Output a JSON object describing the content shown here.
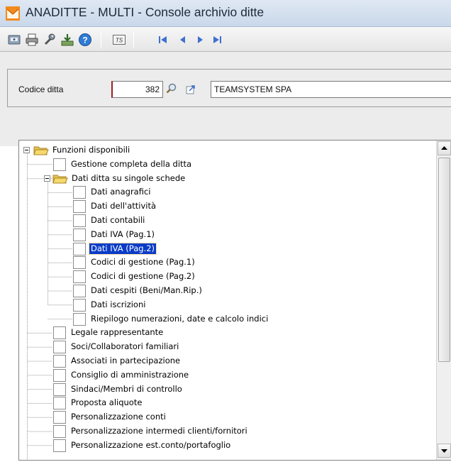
{
  "window": {
    "title": "ANADITTE  - MULTI -  Console archivio ditte",
    "accent": "#f28a1c"
  },
  "toolbar": {
    "buttons": [
      {
        "icon": "disk-icon"
      },
      {
        "icon": "print-icon"
      },
      {
        "icon": "tools-icon"
      },
      {
        "icon": "download-icon"
      },
      {
        "icon": "help-icon"
      },
      {
        "icon": "ts-icon",
        "label": "TS"
      },
      {
        "icon": "first-record-icon"
      },
      {
        "icon": "previous-record-icon"
      },
      {
        "icon": "next-record-icon"
      },
      {
        "icon": "last-record-icon"
      }
    ]
  },
  "company": {
    "code_label": "Codice ditta",
    "code_value": "382",
    "name_value": "TEAMSYSTEM SPA"
  },
  "tree": {
    "root": "Funzioni disponibili",
    "items": [
      {
        "label": "Gestione completa della ditta",
        "level": 1,
        "type": "leaf"
      },
      {
        "label": "Dati ditta su singole schede",
        "level": 1,
        "type": "folder",
        "expanded": true
      },
      {
        "label": "Dati anagrafici",
        "level": 2,
        "type": "leaf"
      },
      {
        "label": "Dati dell'attività",
        "level": 2,
        "type": "leaf"
      },
      {
        "label": "Dati contabili",
        "level": 2,
        "type": "leaf"
      },
      {
        "label": "Dati IVA (Pag.1)",
        "level": 2,
        "type": "leaf"
      },
      {
        "label": "Dati IVA (Pag.2)",
        "level": 2,
        "type": "leaf",
        "selected": true
      },
      {
        "label": "Codici di gestione (Pag.1)",
        "level": 2,
        "type": "leaf"
      },
      {
        "label": "Codici di gestione (Pag.2)",
        "level": 2,
        "type": "leaf"
      },
      {
        "label": "Dati cespiti (Beni/Man.Rip.)",
        "level": 2,
        "type": "leaf"
      },
      {
        "label": "Dati iscrizioni",
        "level": 2,
        "type": "leaf"
      },
      {
        "label": "Riepilogo numerazioni, date e calcolo indici",
        "level": 2,
        "type": "leaf"
      },
      {
        "label": "Legale rappresentante",
        "level": 1,
        "type": "leaf"
      },
      {
        "label": "Soci/Collaboratori familiari",
        "level": 1,
        "type": "leaf"
      },
      {
        "label": "Associati in partecipazione",
        "level": 1,
        "type": "leaf"
      },
      {
        "label": "Consiglio di amministrazione",
        "level": 1,
        "type": "leaf"
      },
      {
        "label": "Sindaci/Membri di controllo",
        "level": 1,
        "type": "leaf"
      },
      {
        "label": "Proposta aliquote",
        "level": 1,
        "type": "leaf"
      },
      {
        "label": "Personalizzazione conti",
        "level": 1,
        "type": "leaf"
      },
      {
        "label": "Personalizzazione intermedi clienti/fornitori",
        "level": 1,
        "type": "leaf"
      },
      {
        "label": "Personalizzazione est.conto/portafoglio",
        "level": 1,
        "type": "leaf"
      }
    ],
    "selection_color": "#0a3cc8"
  },
  "scrollbar": {
    "up_icon": "arrow-up-icon",
    "down_icon": "arrow-down-icon"
  }
}
